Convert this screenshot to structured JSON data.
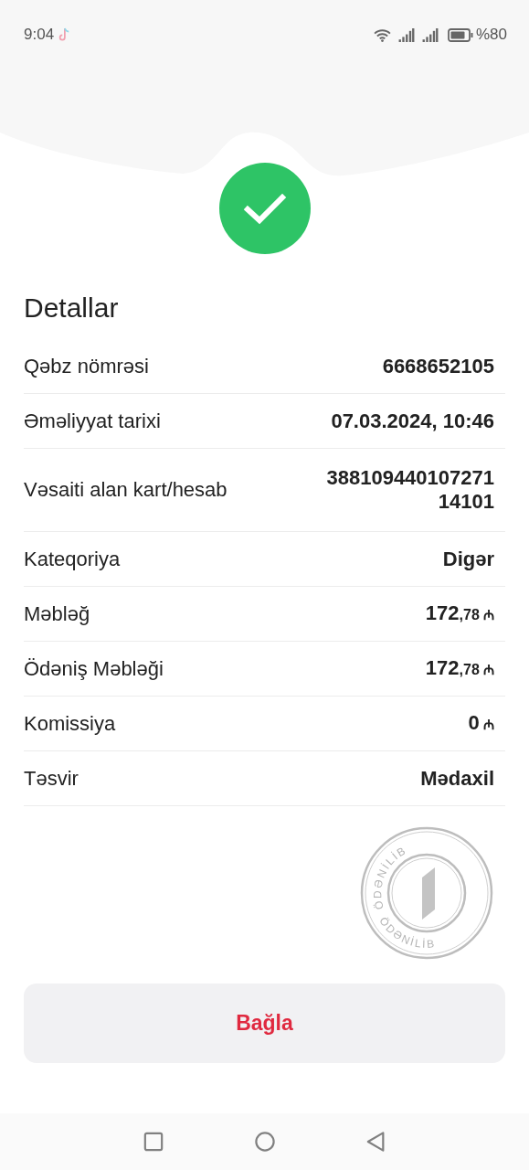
{
  "status_bar": {
    "time": "9:04",
    "battery_text": "%80"
  },
  "title": "Detallar",
  "details": [
    {
      "label": "Qəbz nömrəsi",
      "kind": "text",
      "value": "6668652105"
    },
    {
      "label": "Əməliyyat tarixi",
      "kind": "text",
      "value": "07.03.2024, 10:46"
    },
    {
      "label": "Vəsaiti alan kart/hesab",
      "kind": "text",
      "value": "38810944010727114101"
    },
    {
      "label": "Kateqoriya",
      "kind": "text",
      "value": "Digər"
    },
    {
      "label": "Məbləğ",
      "kind": "amount",
      "main": "172",
      "fraction": ",78",
      "currency": "₼"
    },
    {
      "label": "Ödəniş Məbləği",
      "kind": "amount",
      "main": "172",
      "fraction": ",78",
      "currency": "₼"
    },
    {
      "label": "Komissiya",
      "kind": "amount",
      "main": "0",
      "currency": "₼"
    },
    {
      "label": "Təsvir",
      "kind": "text",
      "value": "Mədaxil"
    }
  ],
  "stamp": {
    "texts": [
      "ÖDƏNİLİB",
      "ÖDƏNİLİB"
    ]
  },
  "button": "Bağla"
}
